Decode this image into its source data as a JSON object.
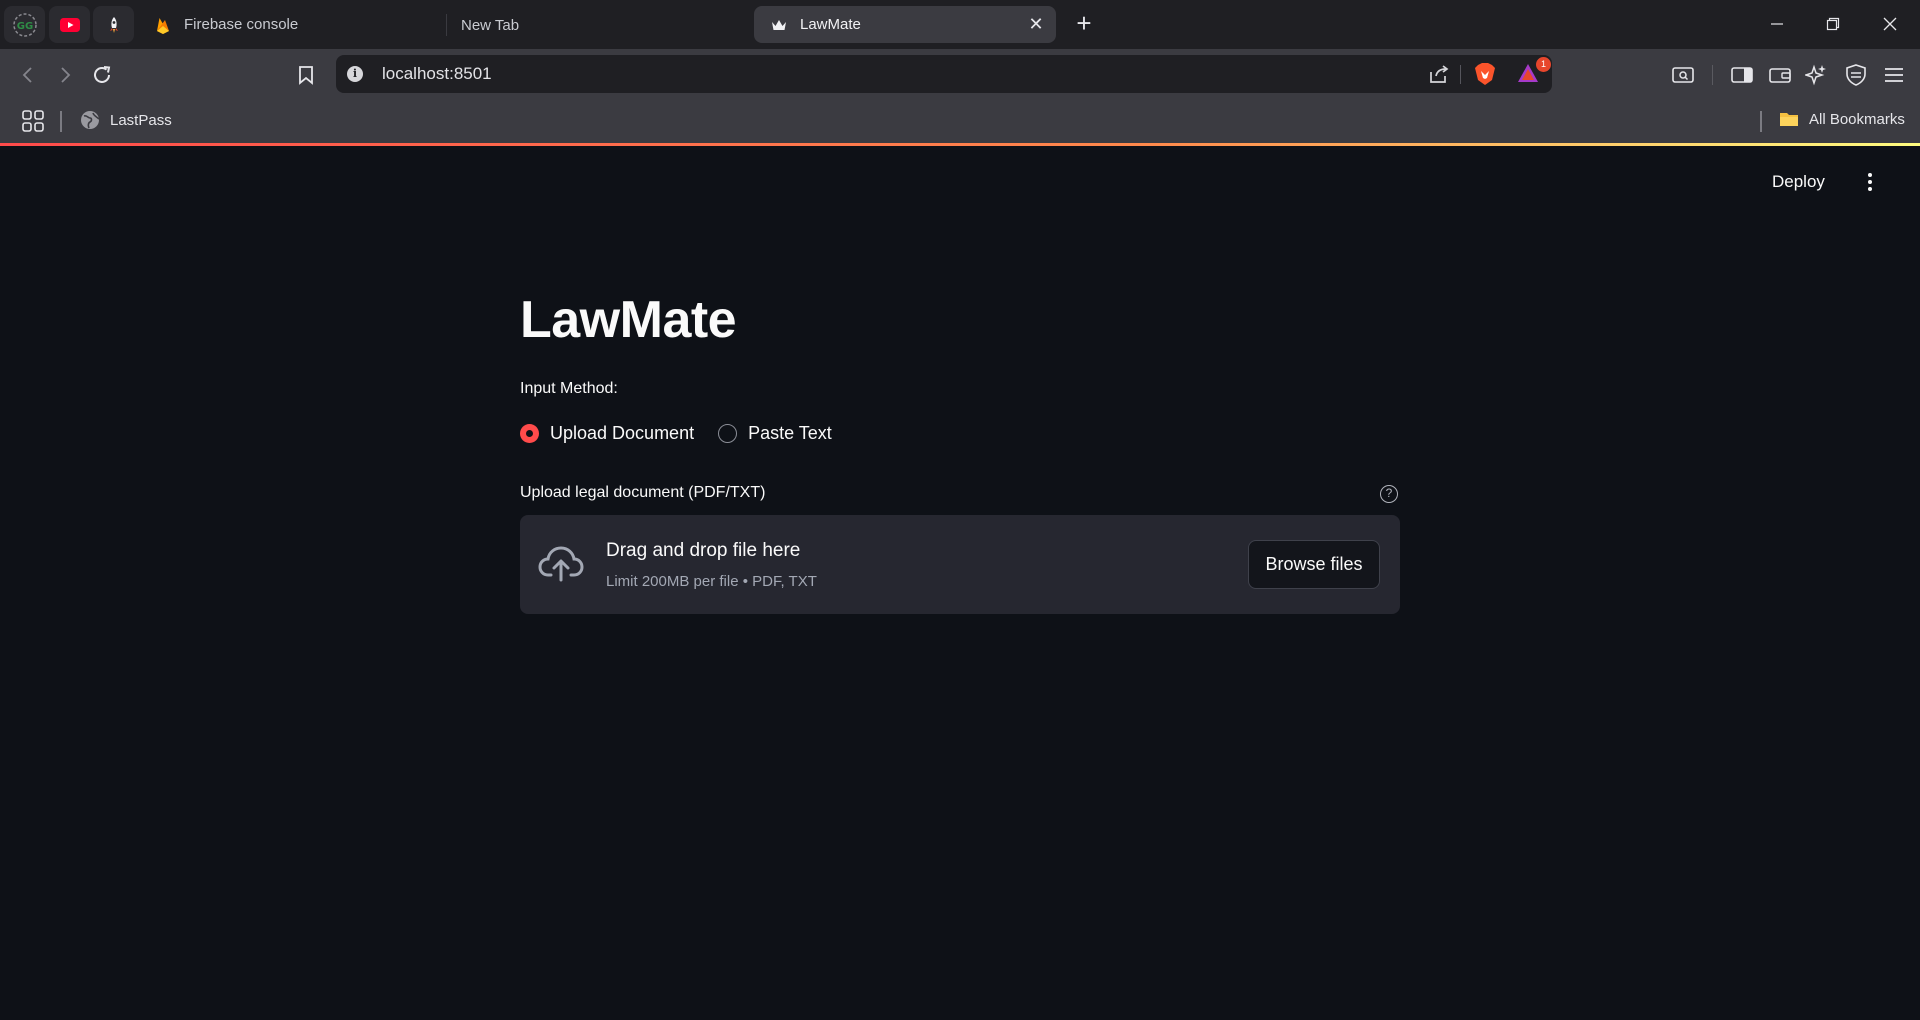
{
  "browser": {
    "pinned_tabs": [
      {
        "icon": "geeks-logo-icon"
      },
      {
        "icon": "youtube-icon"
      },
      {
        "icon": "rocket-icon"
      }
    ],
    "tabs": [
      {
        "title": "Firebase console",
        "icon": "firebase-icon"
      },
      {
        "title": "New Tab"
      },
      {
        "title": "LawMate",
        "icon": "crown-icon",
        "active": true
      }
    ],
    "address": "localhost:8501",
    "rewards_badge": "1",
    "bookmarks": [
      {
        "label": "LastPass",
        "icon": "globe-icon"
      }
    ],
    "all_bookmarks_label": "All Bookmarks"
  },
  "app": {
    "deploy_label": "Deploy",
    "title": "LawMate",
    "input_method_label": "Input Method:",
    "radio_options": [
      {
        "label": "Upload Document",
        "selected": true
      },
      {
        "label": "Paste Text",
        "selected": false
      }
    ],
    "uploader": {
      "label": "Upload legal document (PDF/TXT)",
      "help": "?",
      "drop_title": "Drag and drop file here",
      "drop_subtitle": "Limit 200MB per file • PDF, TXT",
      "browse_label": "Browse files"
    }
  },
  "colors": {
    "accent": "#ff4b4b",
    "background": "#0e1117",
    "dropzone": "#262730",
    "chrome": "#3b3b41"
  }
}
